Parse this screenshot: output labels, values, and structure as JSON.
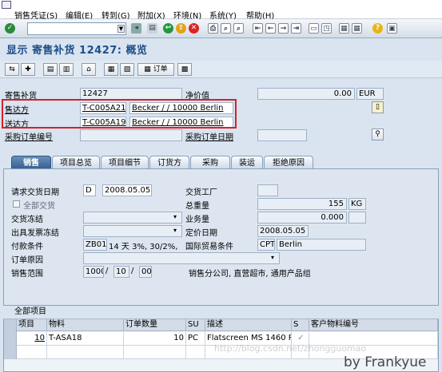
{
  "menu": {
    "items": [
      "销售凭证(S)",
      "编辑(E)",
      "转到(G)",
      "附加(X)",
      "环境(N)",
      "系统(Y)",
      "帮助(H)"
    ]
  },
  "toolbar": {
    "command_value": ""
  },
  "title": "显示 寄售补货 12427: 概览",
  "app_toolbar": {
    "order_button": "订单"
  },
  "header": {
    "consign_label": "寄售补货",
    "consign_value": "12427",
    "net_value_label": "净价值",
    "net_value": "0.00",
    "currency": "EUR",
    "sold_to_label": "售达方",
    "sold_to_code": "T-C005A21",
    "sold_to_name": "Becker / / 10000 Berlin",
    "ship_to_label": "送达方",
    "ship_to_code": "T-C005A19",
    "ship_to_name": "Becker / / 10000 Berlin",
    "po_number_label": "采购订单编号",
    "po_date_label": "采购订单日期"
  },
  "tabs": [
    "销售",
    "项目总览",
    "项目细节",
    "订货方",
    "采购",
    "装运",
    "拒绝原因"
  ],
  "sales_tab": {
    "req_delivery_label": "请求交货日期",
    "req_delivery_unit": "D",
    "req_delivery_date": "2008.05.05",
    "deliver_plant_label": "交货工厂",
    "complete_delivery_label": "全部交货",
    "total_weight_label": "总重量",
    "total_weight": "155",
    "weight_unit": "KG",
    "delivery_block_label": "交货冻结",
    "volume_label": "业务量",
    "volume": "0.000",
    "billing_block_label": "出具发票冻结",
    "pricing_date_label": "定价日期",
    "pricing_date": "2008.05.05",
    "payment_terms_label": "付款条件",
    "payment_terms_code": "ZB01",
    "payment_terms_text": "14 天  3%, 30/2%,",
    "incoterms_label": "国际贸易条件",
    "incoterms_code": "CPT",
    "incoterms_place": "Berlin",
    "order_reason_label": "订单原因",
    "sales_area_label": "销售范围",
    "sales_org": "1000",
    "dist_channel": "10",
    "division": "00",
    "sales_area_text": "销售分公司, 直营超市, 通用产品组"
  },
  "items_table": {
    "title": "全部项目",
    "columns": [
      "项目",
      "物料",
      "订单数量",
      "SU",
      "描述",
      "S",
      "客户物料编号"
    ],
    "rows": [
      {
        "item": "10",
        "material": "T-ASA18",
        "quantity": "10",
        "su": "PC",
        "description": "Flatscreen MS 1460 P",
        "s": "✓",
        "cust_material": ""
      }
    ]
  },
  "watermarks": {
    "blog": "http://blog.csdn.net/zhongguomao",
    "author": "by Frankyue"
  }
}
